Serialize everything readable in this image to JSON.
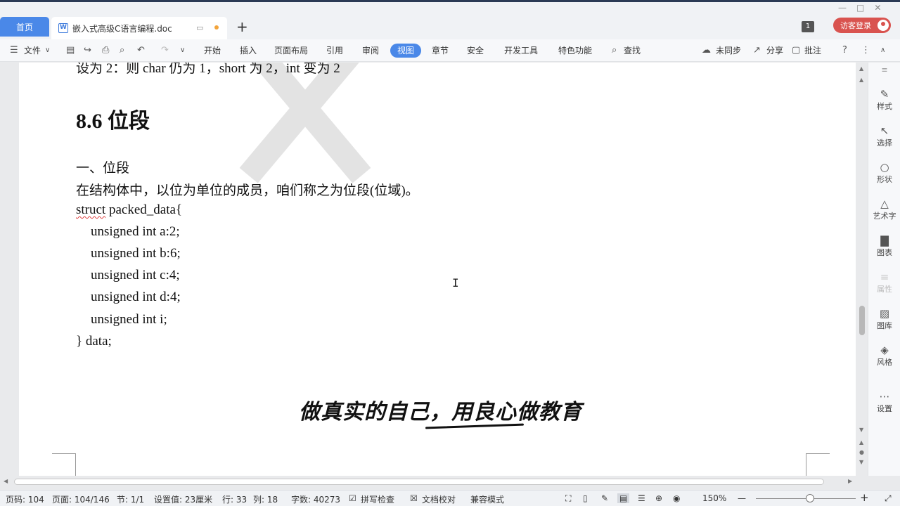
{
  "titlebar": {
    "home_tab": "首页",
    "doc_tab": "嵌入式高级C语言编程.doc",
    "doc_icon": "W",
    "new_tab": "+",
    "badge": "1",
    "login": "访客登录"
  },
  "toolbar": {
    "file_menu": "文件",
    "tabs": [
      "开始",
      "插入",
      "页面布局",
      "引用",
      "审阅",
      "视图",
      "章节",
      "安全",
      "开发工具",
      "特色功能"
    ],
    "active_tab": "视图",
    "search": "查找",
    "sync": "未同步",
    "share": "分享",
    "comment": "批注"
  },
  "document": {
    "top_line": "设为 2：则 char 仍为 1，short 为 2，int 变为 2",
    "heading": "8.6  位段",
    "subheading": "一、位段",
    "intro": "在结构体中，以位为单位的成员，咱们称之为位段(位域)。",
    "code_struct_word": "struct",
    "code_struct_rest": " packed_data{",
    "code_lines": [
      "unsigned int a:2;",
      "unsigned int b:6;",
      "unsigned int c:4;",
      "unsigned int d:4;",
      "unsigned int i;"
    ],
    "code_end": "} data;",
    "slogan": "做真实的自己，用良心做教育"
  },
  "sidebar": {
    "items": [
      {
        "label": "样式",
        "icon": "pen-icon"
      },
      {
        "label": "选择",
        "icon": "cursor-icon"
      },
      {
        "label": "形状",
        "icon": "shapes-icon"
      },
      {
        "label": "艺术字",
        "icon": "wordart-icon"
      },
      {
        "label": "图表",
        "icon": "chart-icon"
      },
      {
        "label": "属性",
        "icon": "properties-icon"
      },
      {
        "label": "图库",
        "icon": "image-icon"
      },
      {
        "label": "风格",
        "icon": "style-icon"
      },
      {
        "label": "设置",
        "icon": "more-icon"
      }
    ]
  },
  "statusbar": {
    "page_num": "页码: 104",
    "pages": "页面: 104/146",
    "section": "节: 1/1",
    "setting": "设置值: 23厘米",
    "row": "行: 33",
    "col": "列: 18",
    "words": "字数: 40273",
    "spellcheck": "拼写检查",
    "proofread": "文档校对",
    "compat": "兼容模式",
    "zoom": "150%"
  }
}
